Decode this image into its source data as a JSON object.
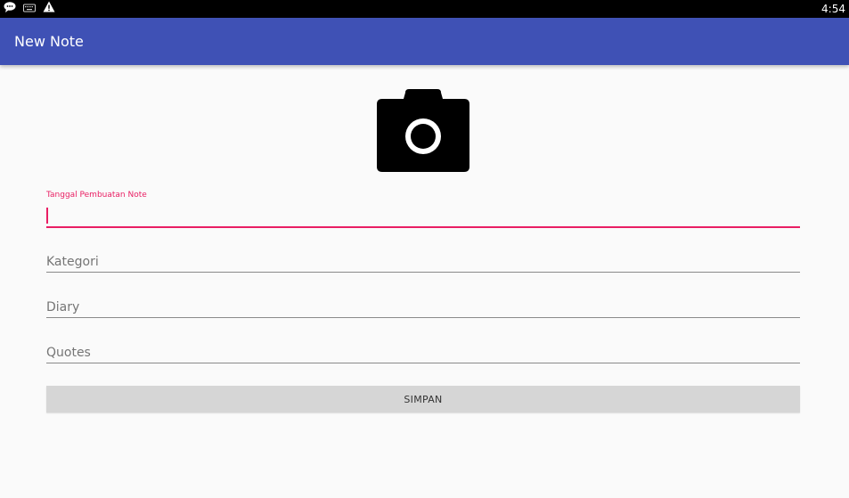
{
  "status_bar": {
    "time": "4:54",
    "icons": [
      "chat-bubble-icon",
      "keyboard-icon",
      "warning-icon"
    ]
  },
  "app_bar": {
    "title": "New Note",
    "color": "#3f51b5"
  },
  "photo": {
    "icon": "camera-icon"
  },
  "form": {
    "date_field": {
      "label": "Tanggal Pembuatan Note",
      "value": ""
    },
    "category_field": {
      "placeholder": "Kategori",
      "value": ""
    },
    "diary_field": {
      "placeholder": "Diary",
      "value": ""
    },
    "quotes_field": {
      "placeholder": "Quotes",
      "value": ""
    },
    "accent_color": "#e91e63"
  },
  "save_button": {
    "label": "SIMPAN"
  }
}
